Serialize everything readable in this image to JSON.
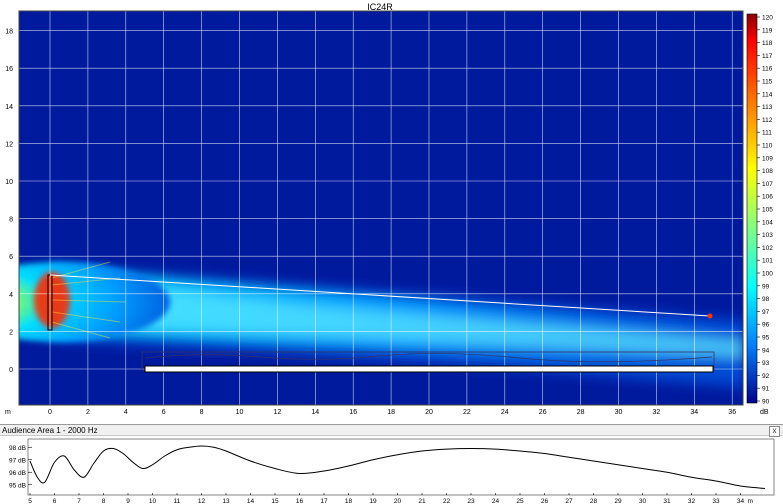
{
  "title": "IC24R",
  "main_plot": {
    "y_ticks": [
      "0",
      "2",
      "4",
      "6",
      "8",
      "10",
      "12",
      "14",
      "16",
      "18"
    ],
    "x_ticks": [
      "0",
      "2",
      "4",
      "6",
      "8",
      "10",
      "12",
      "14",
      "16",
      "18",
      "20",
      "22",
      "24",
      "26",
      "28",
      "30",
      "32",
      "34",
      "36"
    ],
    "axis_unit": "m",
    "colors": {
      "background": "#001a9e",
      "grid": "#ffffff"
    }
  },
  "colorbar": {
    "labels": [
      "120",
      "119",
      "118",
      "117",
      "116",
      "115",
      "114",
      "113",
      "112",
      "111",
      "110",
      "109",
      "108",
      "107",
      "106",
      "105",
      "104",
      "103",
      "102",
      "101",
      "100",
      "99",
      "98",
      "97",
      "96",
      "95",
      "94",
      "93",
      "92",
      "91",
      "90"
    ],
    "unit": "dB"
  },
  "audience_panel": {
    "title": "Audience Area 1 - 2000 Hz",
    "close_label": "x",
    "y_labels": [
      "98 dB",
      "97 dB",
      "96 dB",
      "95 dB"
    ],
    "x_labels": [
      "5",
      "6",
      "7",
      "8",
      "9",
      "10",
      "11",
      "12",
      "13",
      "14",
      "15",
      "16",
      "17",
      "18",
      "19",
      "20",
      "21",
      "22",
      "23",
      "24",
      "25",
      "26",
      "27",
      "28",
      "29",
      "30",
      "31",
      "32",
      "33",
      "34"
    ],
    "x_unit": "m"
  },
  "chart_data": {
    "type": "line",
    "title": "Audience Area 1 - 2000 Hz",
    "xlabel": "m",
    "ylabel": "dB",
    "xlim": [
      5,
      35
    ],
    "ylim": [
      94.5,
      98.5
    ],
    "x": [
      5,
      5.3,
      5.6,
      6,
      6.4,
      6.8,
      7.2,
      7.6,
      8,
      8.4,
      8.8,
      9.2,
      9.6,
      10,
      10.5,
      11,
      11.5,
      12,
      12.5,
      13,
      14,
      15,
      16,
      17,
      18,
      19,
      20,
      21,
      22,
      23,
      24,
      25,
      26,
      27,
      28,
      29,
      30,
      31,
      32,
      33,
      34,
      35
    ],
    "values": [
      96.9,
      95.6,
      95.2,
      96.8,
      97.3,
      96.2,
      95.6,
      96.7,
      97.7,
      97.9,
      97.5,
      96.8,
      96.3,
      96.6,
      97.3,
      97.8,
      98.0,
      98.1,
      98.0,
      97.7,
      96.9,
      96.3,
      95.9,
      96.1,
      96.5,
      97.0,
      97.4,
      97.7,
      97.85,
      97.9,
      97.85,
      97.7,
      97.5,
      97.2,
      96.9,
      96.6,
      96.3,
      96.0,
      95.6,
      95.3,
      94.9,
      94.7
    ]
  }
}
